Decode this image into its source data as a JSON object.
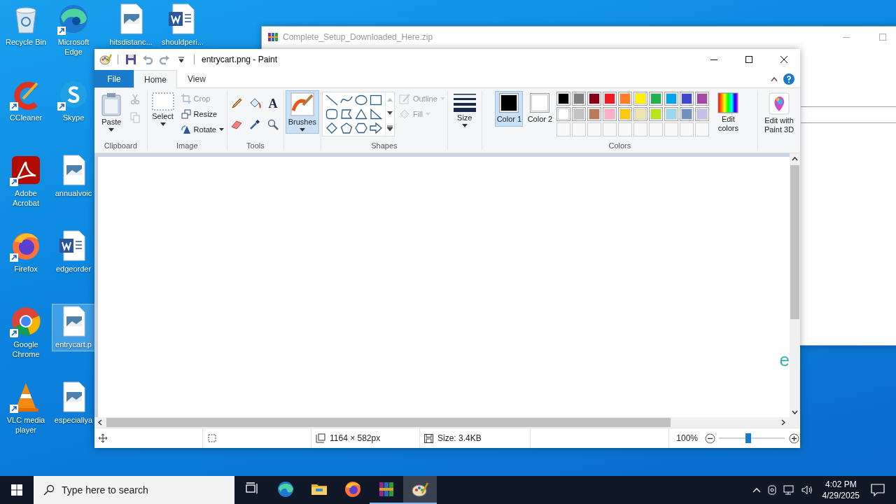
{
  "desktop_icons": [
    {
      "label": "Recycle Bin",
      "kind": "recycle-bin",
      "shortcut": false,
      "selected": false
    },
    {
      "label": "CCleaner",
      "kind": "ccleaner",
      "shortcut": true,
      "selected": false
    },
    {
      "label": "Adobe Acrobat",
      "kind": "acrobat",
      "shortcut": true,
      "selected": false
    },
    {
      "label": "Firefox",
      "kind": "firefox",
      "shortcut": true,
      "selected": false
    },
    {
      "label": "Google Chrome",
      "kind": "chrome",
      "shortcut": true,
      "selected": false
    },
    {
      "label": "VLC media player",
      "kind": "vlc",
      "shortcut": true,
      "selected": false
    },
    {
      "label": "Microsoft Edge",
      "kind": "edge",
      "shortcut": true,
      "selected": false
    },
    {
      "label": "Skype",
      "kind": "skype",
      "shortcut": true,
      "selected": false
    },
    {
      "label": "annualvoic",
      "kind": "image-file",
      "shortcut": false,
      "selected": false
    },
    {
      "label": "edgeorder",
      "kind": "word-file",
      "shortcut": false,
      "selected": false
    },
    {
      "label": "entrycart.p",
      "kind": "image-file",
      "shortcut": false,
      "selected": true
    },
    {
      "label": "especiallya",
      "kind": "image-file",
      "shortcut": false,
      "selected": false
    },
    {
      "label": "hitsdistanc...",
      "kind": "image-file",
      "shortcut": false,
      "selected": false
    },
    {
      "label": "shouldperi...",
      "kind": "word-file",
      "shortcut": false,
      "selected": false
    }
  ],
  "background_window": {
    "title": "Complete_Setup_Downloaded_Here.zip"
  },
  "paint": {
    "title": "entrycart.png - Paint",
    "tabs": [
      {
        "label": "File",
        "kind": "file",
        "selected": false
      },
      {
        "label": "Home",
        "kind": "tab",
        "selected": true
      },
      {
        "label": "View",
        "kind": "tab",
        "selected": false
      }
    ],
    "clipboard": {
      "label": "Clipboard",
      "paste": "Paste",
      "cut": {
        "disabled": true
      },
      "copy": {
        "disabled": true
      }
    },
    "image": {
      "label": "Image",
      "select": "Select",
      "crop": {
        "label": "Crop",
        "disabled": true
      },
      "resize": {
        "label": "Resize",
        "disabled": false
      },
      "rotate": {
        "label": "Rotate",
        "disabled": false
      }
    },
    "tools": {
      "label": "Tools",
      "text_tool": "A"
    },
    "brushes": {
      "label": "Brushes",
      "selected": true
    },
    "shapes": {
      "label": "Shapes",
      "outline": {
        "label": "Outline",
        "disabled": true
      },
      "fill": {
        "label": "Fill",
        "disabled": true
      }
    },
    "size": {
      "label": "Size"
    },
    "colors": {
      "label": "Colors",
      "color1": {
        "label": "Color 1",
        "color": "#000000",
        "selected": true
      },
      "color2": {
        "label": "Color 2",
        "color": "#ffffff",
        "selected": false
      },
      "palette": [
        {
          "kind": "color",
          "color": "#000000"
        },
        {
          "kind": "color",
          "color": "#7f7f7f"
        },
        {
          "kind": "color",
          "color": "#880015"
        },
        {
          "kind": "color",
          "color": "#ed1c24"
        },
        {
          "kind": "color",
          "color": "#ff7f27"
        },
        {
          "kind": "color",
          "color": "#fff200"
        },
        {
          "kind": "color",
          "color": "#22b14c"
        },
        {
          "kind": "color",
          "color": "#00a2e8"
        },
        {
          "kind": "color",
          "color": "#3f48cc"
        },
        {
          "kind": "color",
          "color": "#a349a4"
        },
        {
          "kind": "color",
          "color": "#ffffff"
        },
        {
          "kind": "color",
          "color": "#c3c3c3"
        },
        {
          "kind": "color",
          "color": "#b97a57"
        },
        {
          "kind": "color",
          "color": "#ffaec9"
        },
        {
          "kind": "color",
          "color": "#ffc90e"
        },
        {
          "kind": "color",
          "color": "#efe4b0"
        },
        {
          "kind": "color",
          "color": "#b5e61d"
        },
        {
          "kind": "color",
          "color": "#99d9ea"
        },
        {
          "kind": "color",
          "color": "#7092be"
        },
        {
          "kind": "color",
          "color": "#c8bfe7"
        },
        {
          "kind": "empty"
        },
        {
          "kind": "empty"
        },
        {
          "kind": "empty"
        },
        {
          "kind": "empty"
        },
        {
          "kind": "empty"
        },
        {
          "kind": "empty"
        },
        {
          "kind": "empty"
        },
        {
          "kind": "empty"
        },
        {
          "kind": "empty"
        },
        {
          "kind": "empty"
        }
      ],
      "edit": "Edit colors"
    },
    "paint3d": "Edit with Paint 3D",
    "canvas": {
      "text": "e"
    },
    "status": {
      "dimensions": "1164 × 582px",
      "size": "Size: 3.4KB",
      "zoom": "100%",
      "zoom_slider": {
        "level": 0.45
      }
    }
  },
  "taskbar": {
    "search_placeholder": "Type here to search",
    "apps": [
      {
        "kind": "task-view",
        "running": false,
        "selected": false
      },
      {
        "kind": "edge",
        "running": false,
        "selected": false
      },
      {
        "kind": "explorer",
        "running": false,
        "selected": false
      },
      {
        "kind": "firefox",
        "running": false,
        "selected": false
      },
      {
        "kind": "winrar",
        "running": true,
        "selected": false
      },
      {
        "kind": "paint",
        "running": true,
        "selected": true
      }
    ],
    "time": "4:02 PM",
    "date": "4/29/2025"
  }
}
